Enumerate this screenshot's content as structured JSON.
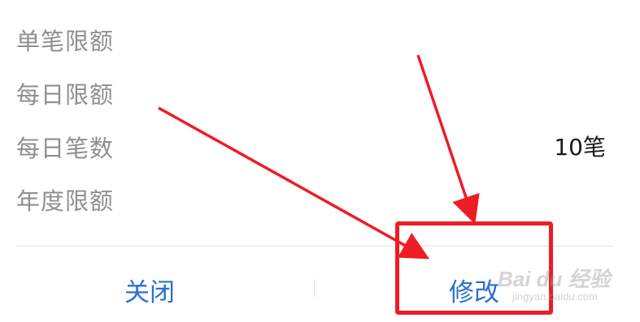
{
  "limits": [
    {
      "label": "单笔限额",
      "value": ""
    },
    {
      "label": "每日限额",
      "value": ""
    },
    {
      "label": "每日笔数",
      "value": "10笔"
    },
    {
      "label": "年度限额",
      "value": ""
    }
  ],
  "actions": {
    "close_label": "关闭",
    "modify_label": "修改"
  },
  "annotation": {
    "color": "#ee1c24"
  },
  "watermark": {
    "brand": "Bai du 经验",
    "url": "jingyan.baidu.com"
  }
}
